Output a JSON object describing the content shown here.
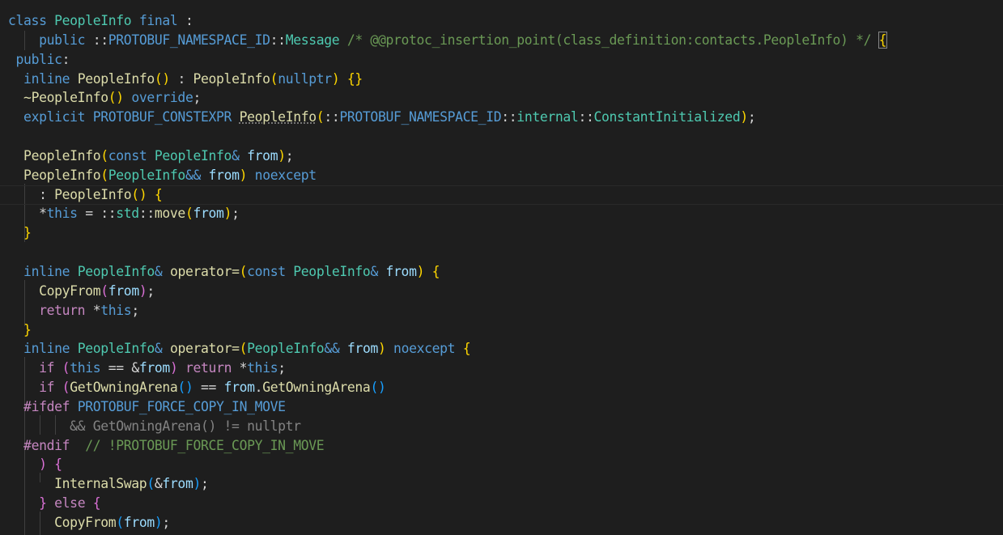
{
  "editor": {
    "language": "cpp",
    "theme": "dark",
    "current_line_index": 9,
    "lines": [
      [
        [
          "kw",
          "class"
        ],
        [
          "pl",
          " "
        ],
        [
          "ty",
          "PeopleInfo"
        ],
        [
          "pl",
          " "
        ],
        [
          "kw",
          "final"
        ],
        [
          "pl",
          " :"
        ]
      ],
      [
        [
          "pl",
          "    "
        ],
        [
          "kw",
          "public"
        ],
        [
          "pl",
          " "
        ],
        [
          "pl",
          "::"
        ],
        [
          "mac",
          "PROTOBUF_NAMESPACE_ID"
        ],
        [
          "pl",
          "::"
        ],
        [
          "ty",
          "Message"
        ],
        [
          "pl",
          " "
        ],
        [
          "cm",
          "/* @@protoc_insertion_point(class_definition:contacts.PeopleInfo) */"
        ],
        [
          "pl",
          " "
        ],
        [
          "b1",
          "{"
        ]
      ],
      [
        [
          "pl",
          " "
        ],
        [
          "kw",
          "public"
        ],
        [
          "pl",
          ":"
        ]
      ],
      [
        [
          "pl",
          "  "
        ],
        [
          "kw",
          "inline"
        ],
        [
          "pl",
          " "
        ],
        [
          "fn",
          "PeopleInfo"
        ],
        [
          "b1",
          "()"
        ],
        [
          "pl",
          " : "
        ],
        [
          "fn",
          "PeopleInfo"
        ],
        [
          "b1",
          "("
        ],
        [
          "kw",
          "nullptr"
        ],
        [
          "b1",
          ")"
        ],
        [
          "pl",
          " "
        ],
        [
          "b1",
          "{}"
        ]
      ],
      [
        [
          "pl",
          "  "
        ],
        [
          "fn",
          "~PeopleInfo"
        ],
        [
          "b1",
          "()"
        ],
        [
          "pl",
          " "
        ],
        [
          "kw",
          "override"
        ],
        [
          "pl",
          ";"
        ]
      ],
      [
        [
          "pl",
          "  "
        ],
        [
          "kw",
          "explicit"
        ],
        [
          "pl",
          " "
        ],
        [
          "mac",
          "PROTOBUF_CONSTEXPR"
        ],
        [
          "pl",
          " "
        ],
        [
          "fn",
          "PeopleInfo"
        ],
        [
          "b1",
          "("
        ],
        [
          "pl",
          "::"
        ],
        [
          "mac",
          "PROTOBUF_NAMESPACE_ID"
        ],
        [
          "pl",
          "::"
        ],
        [
          "ty",
          "internal"
        ],
        [
          "pl",
          "::"
        ],
        [
          "ty",
          "ConstantInitialized"
        ],
        [
          "b1",
          ")"
        ],
        [
          "pl",
          ";"
        ]
      ],
      [],
      [
        [
          "pl",
          "  "
        ],
        [
          "fn",
          "PeopleInfo"
        ],
        [
          "b1",
          "("
        ],
        [
          "kw",
          "const"
        ],
        [
          "pl",
          " "
        ],
        [
          "ty",
          "PeopleInfo"
        ],
        [
          "kw",
          "&"
        ],
        [
          "pl",
          " "
        ],
        [
          "var",
          "from"
        ],
        [
          "b1",
          ")"
        ],
        [
          "pl",
          ";"
        ]
      ],
      [
        [
          "pl",
          "  "
        ],
        [
          "fn",
          "PeopleInfo"
        ],
        [
          "b1",
          "("
        ],
        [
          "ty",
          "PeopleInfo"
        ],
        [
          "kw",
          "&&"
        ],
        [
          "pl",
          " "
        ],
        [
          "var",
          "from"
        ],
        [
          "b1",
          ")"
        ],
        [
          "pl",
          " "
        ],
        [
          "kw",
          "noexcept"
        ]
      ],
      [
        [
          "pl",
          "    : "
        ],
        [
          "fn",
          "PeopleInfo"
        ],
        [
          "b1",
          "()"
        ],
        [
          "pl",
          " "
        ],
        [
          "b1",
          "{"
        ]
      ],
      [
        [
          "pl",
          "    *"
        ],
        [
          "kw",
          "this"
        ],
        [
          "pl",
          " = ::"
        ],
        [
          "ty",
          "std"
        ],
        [
          "pl",
          "::"
        ],
        [
          "fn",
          "move"
        ],
        [
          "b1",
          "("
        ],
        [
          "var",
          "from"
        ],
        [
          "b1",
          ")"
        ],
        [
          "pl",
          ";"
        ]
      ],
      [
        [
          "pl",
          "  "
        ],
        [
          "b1",
          "}"
        ]
      ],
      [],
      [
        [
          "pl",
          "  "
        ],
        [
          "kw",
          "inline"
        ],
        [
          "pl",
          " "
        ],
        [
          "ty",
          "PeopleInfo"
        ],
        [
          "kw",
          "&"
        ],
        [
          "pl",
          " "
        ],
        [
          "fn",
          "operator="
        ],
        [
          "b1",
          "("
        ],
        [
          "kw",
          "const"
        ],
        [
          "pl",
          " "
        ],
        [
          "ty",
          "PeopleInfo"
        ],
        [
          "kw",
          "&"
        ],
        [
          "pl",
          " "
        ],
        [
          "var",
          "from"
        ],
        [
          "b1",
          ")"
        ],
        [
          "pl",
          " "
        ],
        [
          "b1",
          "{"
        ]
      ],
      [
        [
          "pl",
          "    "
        ],
        [
          "fn",
          "CopyFrom"
        ],
        [
          "b2",
          "("
        ],
        [
          "var",
          "from"
        ],
        [
          "b2",
          ")"
        ],
        [
          "pl",
          ";"
        ]
      ],
      [
        [
          "pl",
          "    "
        ],
        [
          "ctl",
          "return"
        ],
        [
          "pl",
          " *"
        ],
        [
          "kw",
          "this"
        ],
        [
          "pl",
          ";"
        ]
      ],
      [
        [
          "pl",
          "  "
        ],
        [
          "b1",
          "}"
        ]
      ],
      [
        [
          "pl",
          "  "
        ],
        [
          "kw",
          "inline"
        ],
        [
          "pl",
          " "
        ],
        [
          "ty",
          "PeopleInfo"
        ],
        [
          "kw",
          "&"
        ],
        [
          "pl",
          " "
        ],
        [
          "fn",
          "operator="
        ],
        [
          "b1",
          "("
        ],
        [
          "ty",
          "PeopleInfo"
        ],
        [
          "kw",
          "&&"
        ],
        [
          "pl",
          " "
        ],
        [
          "var",
          "from"
        ],
        [
          "b1",
          ")"
        ],
        [
          "pl",
          " "
        ],
        [
          "kw",
          "noexcept"
        ],
        [
          "pl",
          " "
        ],
        [
          "b1",
          "{"
        ]
      ],
      [
        [
          "pl",
          "    "
        ],
        [
          "ctl",
          "if"
        ],
        [
          "pl",
          " "
        ],
        [
          "b2",
          "("
        ],
        [
          "kw",
          "this"
        ],
        [
          "pl",
          " == &"
        ],
        [
          "var",
          "from"
        ],
        [
          "b2",
          ")"
        ],
        [
          "pl",
          " "
        ],
        [
          "ctl",
          "return"
        ],
        [
          "pl",
          " *"
        ],
        [
          "kw",
          "this"
        ],
        [
          "pl",
          ";"
        ]
      ],
      [
        [
          "pl",
          "    "
        ],
        [
          "ctl",
          "if"
        ],
        [
          "pl",
          " "
        ],
        [
          "b2",
          "("
        ],
        [
          "fn",
          "GetOwningArena"
        ],
        [
          "b3",
          "()"
        ],
        [
          "pl",
          " == "
        ],
        [
          "var",
          "from"
        ],
        [
          "pl",
          "."
        ],
        [
          "fn",
          "GetOwningArena"
        ],
        [
          "b3",
          "()"
        ]
      ],
      [
        [
          "pl",
          "  "
        ],
        [
          "ctl",
          "#ifdef"
        ],
        [
          "pl",
          " "
        ],
        [
          "mac",
          "PROTOBUF_FORCE_COPY_IN_MOVE"
        ]
      ],
      [
        [
          "pl",
          "        "
        ],
        [
          "dim",
          "&& GetOwningArena() != nullptr"
        ]
      ],
      [
        [
          "pl",
          "  "
        ],
        [
          "ctl",
          "#endif"
        ],
        [
          "pl",
          "  "
        ],
        [
          "cm",
          "// !PROTOBUF_FORCE_COPY_IN_MOVE"
        ]
      ],
      [
        [
          "pl",
          "    "
        ],
        [
          "b2",
          ")"
        ],
        [
          "pl",
          " "
        ],
        [
          "b2",
          "{"
        ]
      ],
      [
        [
          "pl",
          "      "
        ],
        [
          "fn",
          "InternalSwap"
        ],
        [
          "b3",
          "("
        ],
        [
          "pl",
          "&"
        ],
        [
          "var",
          "from"
        ],
        [
          "b3",
          ")"
        ],
        [
          "pl",
          ";"
        ]
      ],
      [
        [
          "pl",
          "    "
        ],
        [
          "b2",
          "}"
        ],
        [
          "pl",
          " "
        ],
        [
          "ctl",
          "else"
        ],
        [
          "pl",
          " "
        ],
        [
          "b2",
          "{"
        ]
      ],
      [
        [
          "pl",
          "      "
        ],
        [
          "fn",
          "CopyFrom"
        ],
        [
          "b3",
          "("
        ],
        [
          "var",
          "from"
        ],
        [
          "b3",
          ")"
        ],
        [
          "pl",
          ";"
        ]
      ],
      [
        [
          "pl",
          "    "
        ],
        [
          "b2",
          "}"
        ]
      ]
    ]
  },
  "colors": {
    "background": "#1e1e1e",
    "keyword": "#569cd6",
    "control": "#c586c0",
    "type": "#4ec9b0",
    "function": "#dcdcaa",
    "variable": "#9cdcfe",
    "comment": "#6a9955",
    "text": "#d4d4d4",
    "bracket_level_1": "#ffd700",
    "bracket_level_2": "#da70d6",
    "bracket_level_3": "#179fff"
  }
}
